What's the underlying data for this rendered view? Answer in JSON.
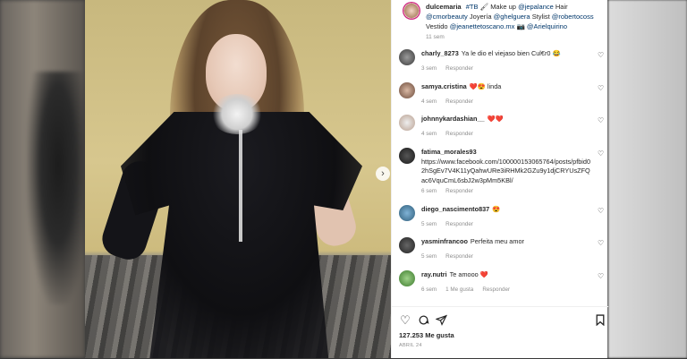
{
  "caption": {
    "username": "dulcemaria",
    "text_parts": [
      "#TB",
      "Make up",
      "@jepalance",
      "Hair",
      "@cmorbeauty",
      "Joyería",
      "@ghelguera",
      "Stylist",
      "@robertocoss",
      "Vestido",
      "@jeanettetoscano.mx",
      "@Arielquirino"
    ],
    "time": "11 sem"
  },
  "comments": [
    {
      "username": "charly_8273",
      "text": "Ya le dio el viejaso bien Cul€r0 😂",
      "time": "3 sem",
      "reply": "Responder",
      "likes": ""
    },
    {
      "username": "samya.cristina",
      "text": "linda",
      "time": "4 sem",
      "reply": "Responder",
      "likes": "",
      "emoji": "❤️😍"
    },
    {
      "username": "johnnykardashian__",
      "text": "",
      "time": "4 sem",
      "reply": "Responder",
      "likes": "",
      "emoji": "❤️❤️"
    },
    {
      "username": "fatima_morales93",
      "text": "https://www.facebook.com/100000153065764/posts/pfbid02hSgEv7V4K11yQahwURe3iRHMk2GZu9y1djCRYUsZFQac6VquCmL6sbJ2w3pMm5KBl/",
      "time": "6 sem",
      "reply": "Responder",
      "likes": ""
    },
    {
      "username": "diego_nascimento837",
      "text": "",
      "time": "5 sem",
      "reply": "Responder",
      "likes": "",
      "emoji": "😍"
    },
    {
      "username": "yasminfrancoo",
      "text": "Perfeita meu amor",
      "time": "5 sem",
      "reply": "Responder",
      "likes": ""
    },
    {
      "username": "ray.nutri",
      "text": "Te amooo",
      "time": "6 sem",
      "reply": "Responder",
      "likes": "1 Me gusta",
      "emoji": "❤️"
    }
  ],
  "actions": {
    "likes": "127.253 Me gusta",
    "date": "ABRIL 24"
  },
  "icons": [
    "heart-icon",
    "comment-icon",
    "share-icon",
    "bookmark-icon",
    "chevron-right-icon"
  ]
}
